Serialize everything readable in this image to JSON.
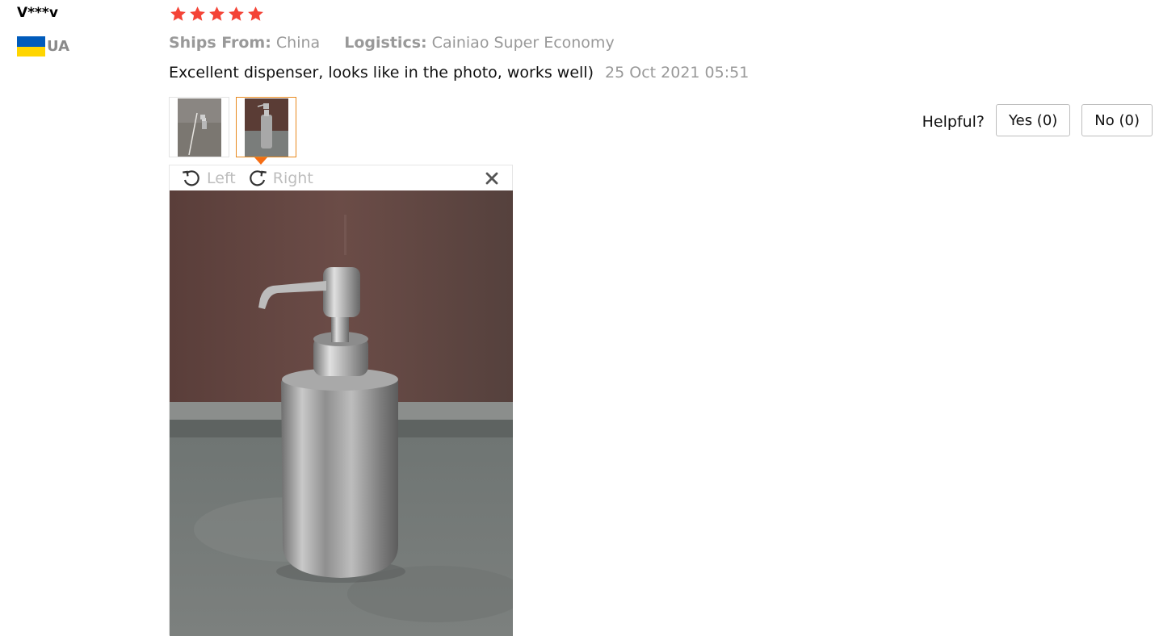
{
  "reviewer": {
    "name": "V***v",
    "country_code": "UA",
    "flag_icon": "ukraine-flag-icon"
  },
  "rating": {
    "stars": 5,
    "max_stars": 5,
    "star_color": "#f44336",
    "star_icon": "star-icon"
  },
  "shipping": {
    "ships_from_label": "Ships From:",
    "ships_from_value": "China",
    "logistics_label": "Logistics:",
    "logistics_value": "Cainiao Super Economy"
  },
  "review": {
    "text": "Excellent dispenser, looks like in the photo, works well)",
    "date": "25 Oct 2021 05:51"
  },
  "photos": {
    "thumbnails": [
      {
        "name": "review-photo-thumbnail-1",
        "active": false
      },
      {
        "name": "review-photo-thumbnail-2",
        "active": true
      }
    ],
    "active_border_color": "#e8891e"
  },
  "helpful": {
    "label": "Helpful?",
    "yes_label": "Yes (0)",
    "no_label": "No (0)"
  },
  "viewer": {
    "rotate_left_label": "Left",
    "rotate_right_label": "Right",
    "rotate_left_icon": "rotate-left-icon",
    "rotate_right_icon": "rotate-right-icon",
    "close_icon": "close-icon"
  }
}
